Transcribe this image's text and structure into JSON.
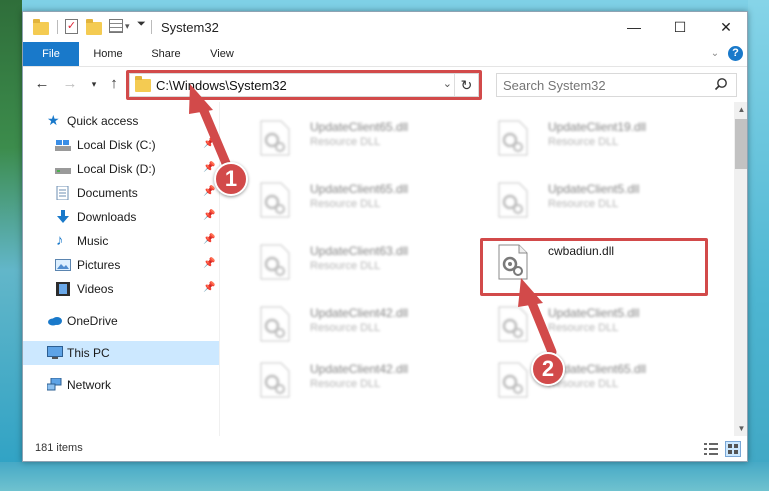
{
  "window": {
    "title": "System32",
    "minimize": "—",
    "maximize": "☐",
    "close": "✕"
  },
  "ribbon": {
    "tabs": [
      "File",
      "Home",
      "Share",
      "View"
    ],
    "help": "?"
  },
  "address": {
    "path": "C:\\Windows\\System32",
    "search_placeholder": "Search System32"
  },
  "sidebar": {
    "items": [
      {
        "label": "Quick access",
        "pinned": false
      },
      {
        "label": "Local Disk (C:)",
        "pinned": true
      },
      {
        "label": "Local Disk (D:)",
        "pinned": true
      },
      {
        "label": "Documents",
        "pinned": true
      },
      {
        "label": "Downloads",
        "pinned": true
      },
      {
        "label": "Music",
        "pinned": true
      },
      {
        "label": "Pictures",
        "pinned": true
      },
      {
        "label": "Videos",
        "pinned": true
      },
      {
        "label": "OneDrive",
        "pinned": false
      },
      {
        "label": "This PC",
        "pinned": false,
        "selected": true
      },
      {
        "label": "Network",
        "pinned": false
      }
    ]
  },
  "files": [
    {
      "name": "UpdateClient65.dll",
      "type": "Resource DLL"
    },
    {
      "name": "UpdateClient19.dll",
      "type": "Resource DLL"
    },
    {
      "name": "UpdateClient65.dll",
      "type": "Resource DLL"
    },
    {
      "name": "UpdateClient5.dll",
      "type": "Resource DLL"
    },
    {
      "name": "UpdateClient63.dll",
      "type": "Resource DLL"
    },
    {
      "name": "cwbadiun.dll",
      "type": ""
    },
    {
      "name": "UpdateClient42.dll",
      "type": "Resource DLL"
    },
    {
      "name": "UpdateClient5.dll",
      "type": "Resource DLL"
    },
    {
      "name": "UpdateClient42.dll",
      "type": "Resource DLL"
    },
    {
      "name": "UpdateClient65.dll",
      "type": "Resource DLL"
    }
  ],
  "status": {
    "item_count": "181 items"
  },
  "annotations": {
    "step1": "1",
    "step2": "2",
    "color": "#d24a4a"
  },
  "colors": {
    "accent": "#1979ca",
    "selection": "#cce8ff",
    "folder": "#f4cb52"
  }
}
